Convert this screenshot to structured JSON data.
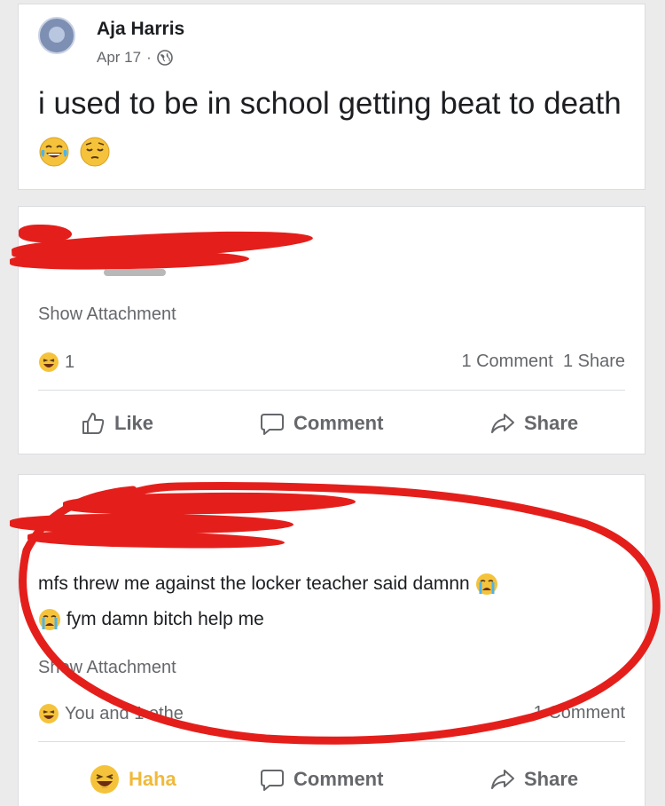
{
  "post": {
    "author": "Aja Harris",
    "date": "Apr 17",
    "separator": "·",
    "text": "i used to be in school getting beat to death",
    "emoji_icons": [
      "tears-of-joy-emoji",
      "pensive-emoji"
    ]
  },
  "comment1": {
    "show_attachment": "Show Attachment",
    "reaction_count": "1",
    "comments_count": "1 Comment",
    "shares_count": "1 Share",
    "actions": {
      "like": "Like",
      "comment": "Comment",
      "share": "Share"
    }
  },
  "comment2": {
    "text_line1": "mfs threw me against the locker teacher said damnn",
    "text_line2": "fym damn bitch help me",
    "show_attachment": "Show Attachment",
    "reactions_text": "You and 1 othe",
    "comments_count": "1 Comment",
    "actions": {
      "haha": "Haha",
      "comment": "Comment",
      "share": "Share"
    }
  },
  "colors": {
    "redaction": "#e41f1b",
    "haha_active": "#f0b93a",
    "secondary_text": "#65676b"
  }
}
